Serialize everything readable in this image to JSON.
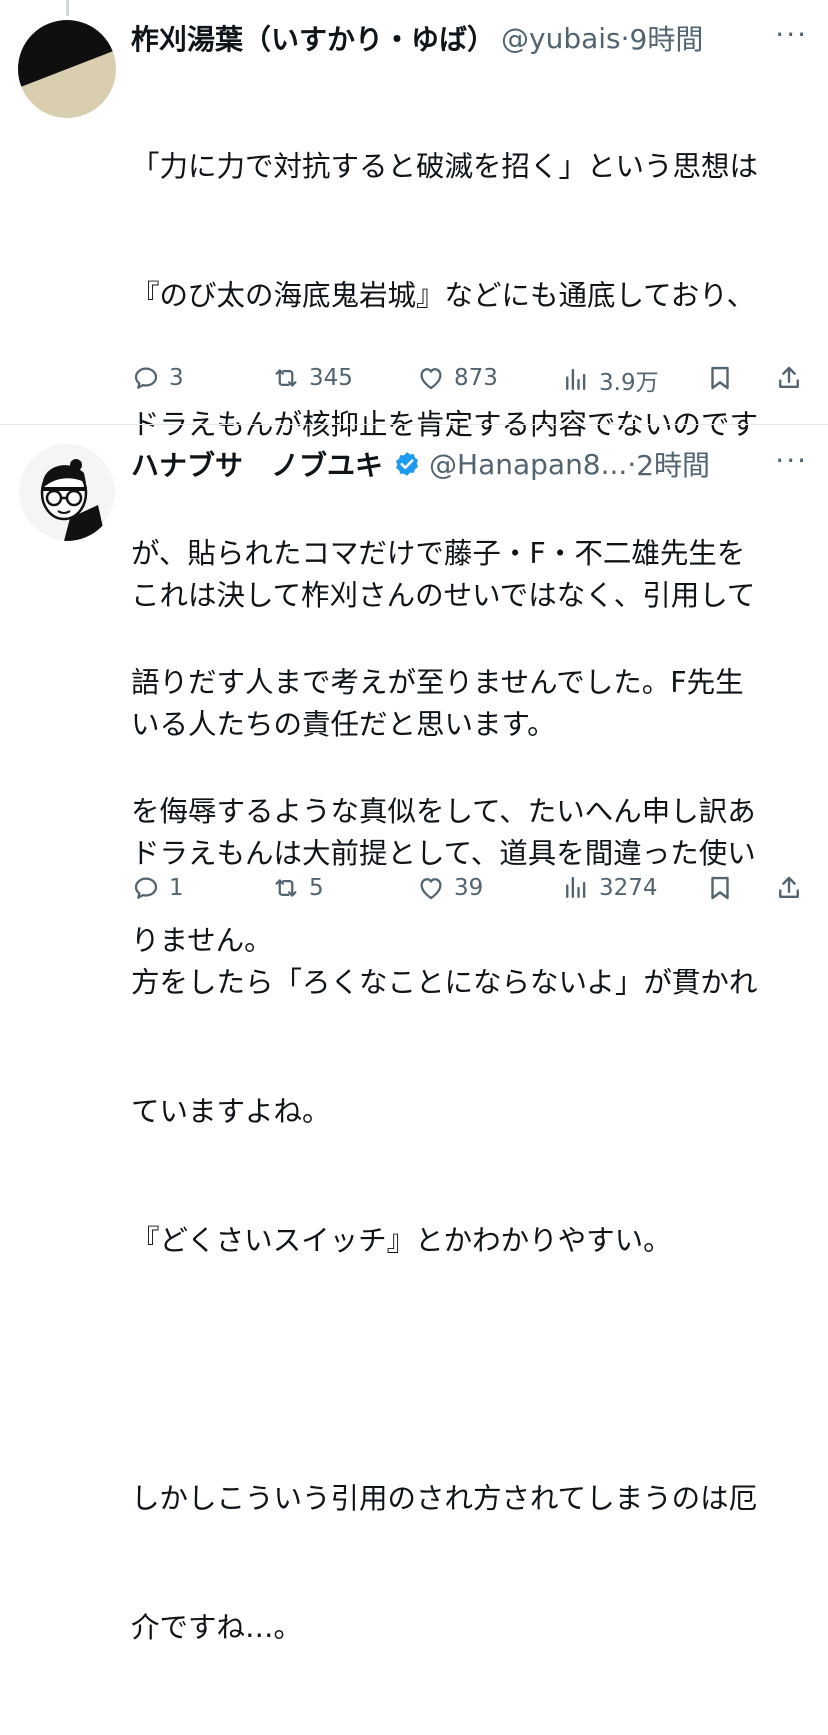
{
  "tweets": [
    {
      "name": "柞刈湯葉（いすかり・ゆば）",
      "handle": "@yubais",
      "dot": "·",
      "time": "9時間",
      "more": "···",
      "lines": [
        "「力に力で対抗すると破滅を招く」という思想は",
        "『のび太の海底鬼岩城』などにも通底しており、",
        "ドラえもんが核抑止を肯定する内容でないのです",
        "が、貼られたコマだけで藤子・F・不二雄先生を",
        "語りだす人まで考えが至りませんでした。F先生",
        "を侮辱するような真似をして、たいへん申し訳あ",
        "りません。"
      ],
      "replies": "3",
      "retweets": "345",
      "likes": "873",
      "views": "3.9万",
      "avatar_colors": {
        "top": "#0f0f0f",
        "bottom": "#d9ceb0"
      }
    },
    {
      "name": "ハナブサ　ノブユキ",
      "handle": "@Hanapan8...",
      "dot": "·",
      "time": "2時間",
      "more": "···",
      "lines": [
        "これは決して柞刈さんのせいではなく、引用して",
        "いる人たちの責任だと思います。",
        "ドラえもんは大前提として、道具を間違った使い",
        "方をしたら「ろくなことにならないよ」が貫かれ",
        "ていますよね。",
        "『どくさいスイッチ』とかわかりやすい。",
        "",
        "しかしこういう引用のされ方されてしまうのは厄",
        "介ですね…。"
      ],
      "replies": "1",
      "retweets": "5",
      "likes": "39",
      "views": "3274",
      "verified_color": "#1d9bf0"
    }
  ],
  "icons": {
    "reply": "reply-icon",
    "retweet": "retweet-icon",
    "like": "heart-icon",
    "views": "views-icon",
    "bookmark": "bookmark-icon",
    "share": "share-icon"
  }
}
